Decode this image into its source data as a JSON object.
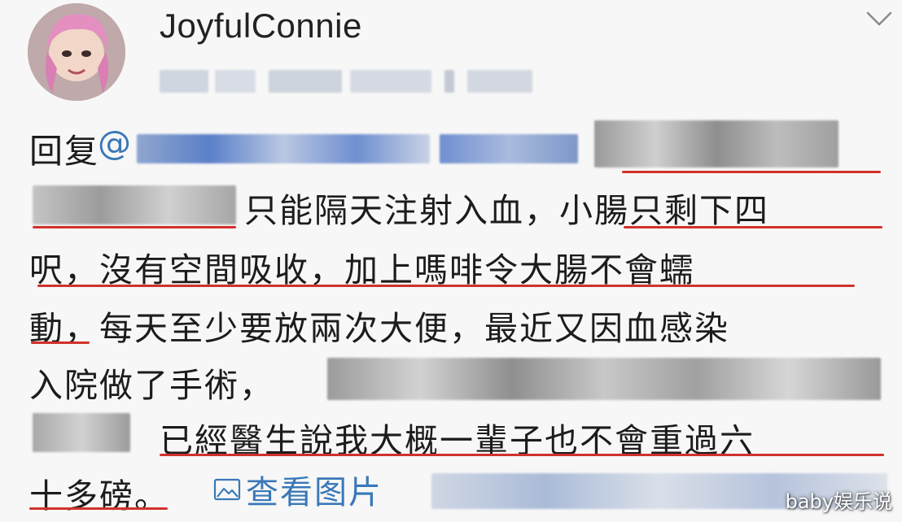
{
  "post": {
    "username": "JoyfulConnie",
    "reply_prefix": "回复",
    "mention_symbol": "@",
    "lines": [
      "只能隔天注射入血，小腸只剩下四",
      "呎，沒有空間吸收，加上嗎啡令大腸不會蠕",
      "動，每天至少要放兩次大便，最近又因血感染",
      "入院做了手術，",
      "已經醫生說我大概一輩子也不會重過六",
      "十多磅。"
    ],
    "view_images_label": "查看图片"
  },
  "watermark": "baby娱乐说",
  "colors": {
    "underline": "#d1312c",
    "link": "#3a78b8",
    "text": "#1c1c1c",
    "background": "#f7f7f7"
  },
  "icons": {
    "avatar": "user-avatar",
    "chevron": "chevron-down-icon",
    "view_images": "image-icon"
  }
}
